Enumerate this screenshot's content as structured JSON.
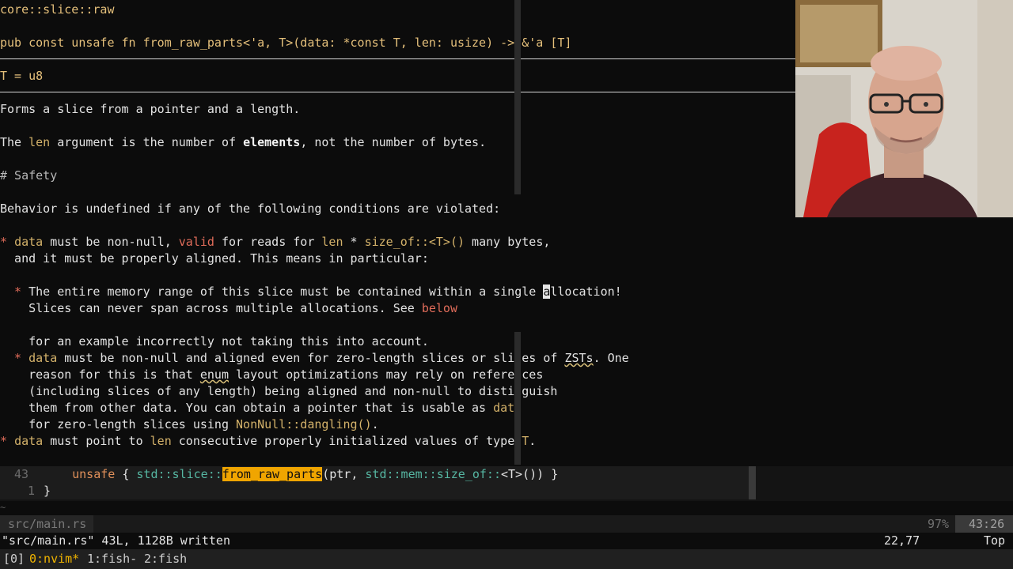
{
  "hover_doc": {
    "module_path": "core::slice::raw",
    "signature": "pub const unsafe fn from_raw_parts<'a, T>(data: *const T, len: usize) -> &'a [T]",
    "type_param": "T = u8",
    "summary": "Forms a slice from a pointer and a length.",
    "len_line": {
      "p1": "The ",
      "code_len": "len",
      "p2": " argument is the number of ",
      "bold": "elements",
      "p3": ", not the number of bytes."
    },
    "safety_heading": "# Safety",
    "ub_line": "Behavior is undefined if any of the following conditions are violated:",
    "b1_l1": {
      "bullet": "* ",
      "data": "data",
      "t1": " must be non-null, ",
      "valid": "valid",
      "t2": " for reads for ",
      "len": "len",
      "t3": " * ",
      "sizeof": "size_of::<T>()",
      "t4": " many bytes,"
    },
    "b1_l2": "  and it must be properly aligned. This means in particular:",
    "sb1_l1": {
      "bullet": "  * ",
      "t1": "The entire memory range of this slice must be contained within a single ",
      "cursor": "a",
      "t2": "llocation!"
    },
    "sb1_l2": {
      "t1": "    Slices can never span across multiple allocations. See ",
      "below": "below"
    },
    "sb1_l3": "    for an example incorrectly not taking this into account.",
    "sb2_l1": {
      "bullet": "  * ",
      "data": "data",
      "t1": " must be non-null and aligned even for zero-length slices or slices of ",
      "zsts": "ZSTs",
      "t2": ". One"
    },
    "sb2_l2": {
      "t1": "    reason for this is that ",
      "enum": "enum",
      "t2": " layout optimizations may rely on references"
    },
    "sb2_l3": "    (including slices of any length) being aligned and non-null to distinguish",
    "sb2_l4": {
      "t1": "    them from other data. You can obtain a pointer that is usable as ",
      "data": "data"
    },
    "sb2_l5": {
      "t1": "    for zero-length slices using ",
      "nonnull": "NonNull::dangling()",
      "t2": "."
    },
    "b2_l1": {
      "bullet": "* ",
      "data": "data",
      "t1": " must point to ",
      "len": "len",
      "t2": " consecutive properly initialized values of type ",
      "T": "T",
      "t3": "."
    }
  },
  "editor": {
    "line1": {
      "num": "43",
      "indent": "    ",
      "kw": "unsafe",
      "t1": " { ",
      "path1": "std::slice::",
      "fn": "from_raw_parts",
      "t2": "(ptr, ",
      "path2": "std::mem::size_of::",
      "t3": "<T>()) }"
    },
    "line2": {
      "num": "1",
      "text": "}"
    },
    "tilde": "~"
  },
  "statusline": {
    "file": "src/main.rs",
    "percent": "97%",
    "position": "43:26"
  },
  "cmdline": {
    "message": "\"src/main.rs\" 43L, 1128B written",
    "cursor_pos": "22,77",
    "scroll": "Top"
  },
  "tmux": {
    "session": "[0]",
    "window0": "0:nvim*",
    "window1": "1:fish-",
    "window2": "2:fish"
  },
  "colors": {
    "accent": "#e5c07b",
    "match": "#f0a500",
    "red": "#e06c5a",
    "teal": "#56b6a2"
  }
}
